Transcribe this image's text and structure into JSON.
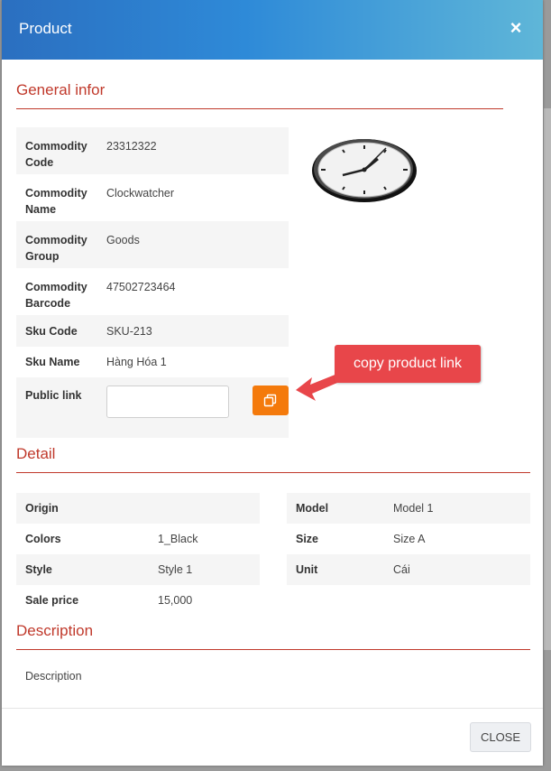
{
  "modal": {
    "title": "Product",
    "close_icon": "close-icon"
  },
  "general": {
    "title": "General infor",
    "rows": [
      {
        "label": "Commodity Code",
        "value": "23312322"
      },
      {
        "label": "Commodity Name",
        "value": "Clockwatcher"
      },
      {
        "label": "Commodity Group",
        "value": "Goods"
      },
      {
        "label": "Commodity Barcode",
        "value": "47502723464"
      },
      {
        "label": "Sku Code",
        "value": "SKU-213"
      },
      {
        "label": "Sku Name",
        "value": "Hàng Hóa 1"
      },
      {
        "label": "Public link",
        "value": ""
      }
    ],
    "copy_icon": "copy-icon",
    "image": "clock-image"
  },
  "callout": {
    "text": "copy product link"
  },
  "detail": {
    "title": "Detail",
    "left": [
      {
        "label": "Origin",
        "value": ""
      },
      {
        "label": "Colors",
        "value": "1_Black"
      },
      {
        "label": "Style",
        "value": "Style 1"
      },
      {
        "label": "Sale price",
        "value": "15,000"
      }
    ],
    "right": [
      {
        "label": "Model",
        "value": "Model 1"
      },
      {
        "label": "Size",
        "value": "Size A"
      },
      {
        "label": "Unit",
        "value": "Cái"
      }
    ]
  },
  "description": {
    "title": "Description",
    "text": "Description"
  },
  "footer": {
    "close_label": "CLOSE"
  },
  "colors": {
    "header_start": "#2b6fc0",
    "header_end": "#5fb6d8",
    "section_accent": "#c0392b",
    "copy_button": "#f47a0c",
    "callout": "#e8464a"
  }
}
